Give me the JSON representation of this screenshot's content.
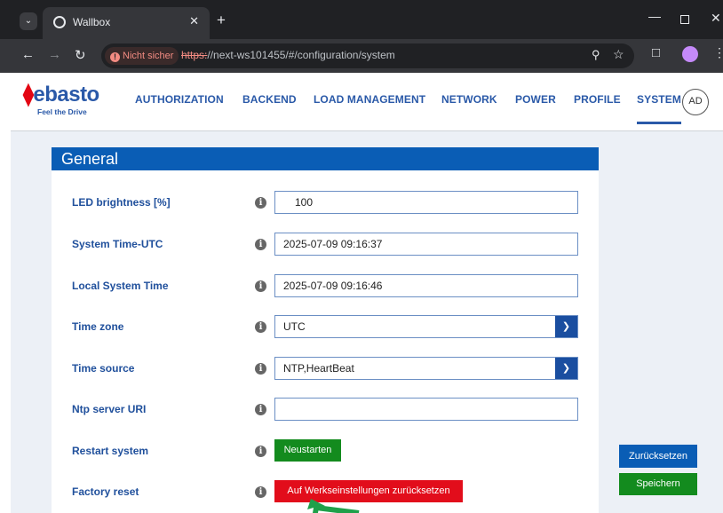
{
  "browser": {
    "tab_title": "Wallbox",
    "security_chip": "Nicht sicher",
    "url_scheme": "https:",
    "url_rest": "//next-ws101455/#/configuration/system"
  },
  "header": {
    "logo_text": "ebasto",
    "logo_sub": "Feel the Drive",
    "nav": [
      "AUTHORIZATION",
      "BACKEND",
      "LOAD MANAGEMENT",
      "NETWORK",
      "POWER",
      "PROFILE",
      "SYSTEM"
    ],
    "active_nav": "SYSTEM",
    "avatar": "AD"
  },
  "panel": {
    "title": "General",
    "fields": {
      "led_brightness": {
        "label": "LED brightness [%]",
        "value": "100"
      },
      "system_time_utc": {
        "label": "System Time-UTC",
        "value": "2025-07-09 09:16:37"
      },
      "local_system_time": {
        "label": "Local System Time",
        "value": "2025-07-09 09:16:46"
      },
      "time_zone": {
        "label": "Time zone",
        "value": "UTC"
      },
      "time_source": {
        "label": "Time source",
        "value": "NTP,HeartBeat"
      },
      "ntp_server_uri": {
        "label": "Ntp server URI",
        "value": ""
      },
      "restart_system": {
        "label": "Restart system",
        "button": "Neustarten"
      },
      "factory_reset": {
        "label": "Factory reset",
        "button": "Auf Werkseinstellungen zurücksetzen"
      }
    }
  },
  "side_actions": {
    "reset": "Zurücksetzen",
    "save": "Speichern"
  },
  "colors": {
    "brand_blue": "#2a59a8",
    "panel_header_blue": "#0a5db5",
    "green": "#138b1e",
    "red": "#e20d1b",
    "cursor_green": "#1fa04a"
  }
}
